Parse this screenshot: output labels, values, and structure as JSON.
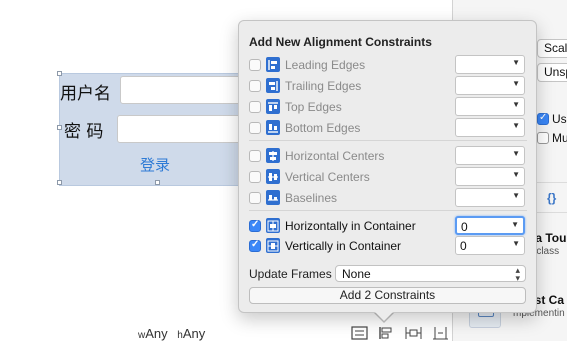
{
  "canvas": {
    "username_label": "用户名",
    "password_label": "密 码",
    "login_button": "登录",
    "size_class": {
      "w_label": "w",
      "w_value": "Any",
      "h_label": "h",
      "h_value": "Any"
    },
    "bottom_tools": [
      "embed-in-stack-icon",
      "align-icon",
      "pin-icon",
      "resolve-issues-icon"
    ]
  },
  "inspector": {
    "popup1": "Scale",
    "popup2": "Unsp",
    "check1": {
      "label": "Use",
      "checked": true
    },
    "check2": {
      "label": "Mu",
      "checked": false
    },
    "brace": "{}",
    "obj_title": "pa Tou",
    "obj_sub": "h class",
    "obj2_title": "est Ca",
    "obj2_sub": "mplementin"
  },
  "popover": {
    "title": "Add New Alignment Constraints",
    "rows": [
      {
        "label": "Leading Edges",
        "checked": false,
        "enabled": false,
        "value": ""
      },
      {
        "label": "Trailing Edges",
        "checked": false,
        "enabled": false,
        "value": ""
      },
      {
        "label": "Top Edges",
        "checked": false,
        "enabled": false,
        "value": ""
      },
      {
        "label": "Bottom Edges",
        "checked": false,
        "enabled": false,
        "value": ""
      },
      {
        "label": "Horizontal Centers",
        "checked": false,
        "enabled": false,
        "value": ""
      },
      {
        "label": "Vertical Centers",
        "checked": false,
        "enabled": false,
        "value": ""
      },
      {
        "label": "Baselines",
        "checked": false,
        "enabled": false,
        "value": ""
      },
      {
        "label": "Horizontally in Container",
        "checked": true,
        "enabled": true,
        "value": "0"
      },
      {
        "label": "Vertically in Container",
        "checked": true,
        "enabled": true,
        "value": "0"
      }
    ],
    "update_frames_label": "Update Frames",
    "update_frames_value": "None",
    "add_button": "Add 2 Constraints"
  },
  "colors": {
    "accent": "#3b87f7",
    "icon_blue": "#2f6fd0",
    "selection_fill": "#cfdaea",
    "link_blue": "#2f7bd5"
  }
}
